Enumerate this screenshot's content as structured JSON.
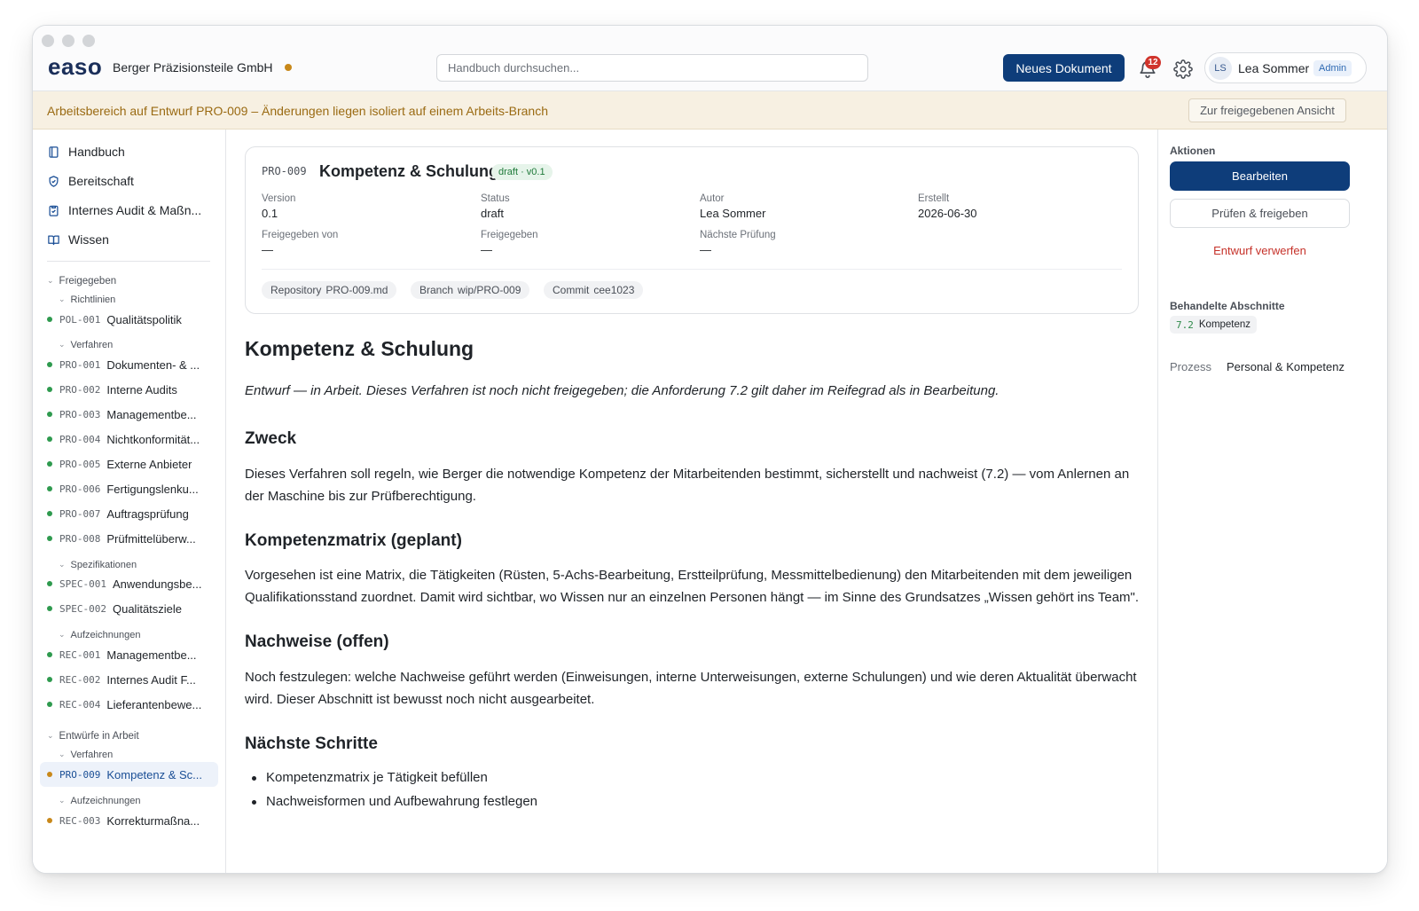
{
  "app": {
    "logo": "easo",
    "company": "Berger Präzisionsteile GmbH",
    "search_placeholder": "Handbuch durchsuchen...",
    "new_doc_label": "Neues Dokument",
    "notifications_count": "12",
    "user": {
      "initials": "LS",
      "name": "Lea Sommer",
      "role": "Admin"
    }
  },
  "banner": {
    "text": "Arbeitsbereich auf Entwurf PRO-009 – Änderungen liegen isoliert auf einem Arbeits-Branch",
    "button": "Zur freigegebenen Ansicht"
  },
  "nav": [
    {
      "label": "Handbuch",
      "icon": "book-icon"
    },
    {
      "label": "Bereitschaft",
      "icon": "shield-icon"
    },
    {
      "label": "Internes Audit & Maßn...",
      "icon": "clipboard-icon"
    },
    {
      "label": "Wissen",
      "icon": "open-book-icon"
    }
  ],
  "tree": {
    "released": "Freigegeben",
    "policies": "Richtlinien",
    "procedures": "Verfahren",
    "specs": "Spezifikationen",
    "records": "Aufzeichnungen",
    "drafts": "Entwürfe in Arbeit",
    "draft_procedures": "Verfahren",
    "draft_records": "Aufzeichnungen",
    "docs": [
      {
        "code": "POL-001",
        "title": "Qualitätspolitik"
      },
      {
        "code": "PRO-001",
        "title": "Dokumenten- & ..."
      },
      {
        "code": "PRO-002",
        "title": "Interne Audits"
      },
      {
        "code": "PRO-003",
        "title": "Managementbe..."
      },
      {
        "code": "PRO-004",
        "title": "Nichtkonformität..."
      },
      {
        "code": "PRO-005",
        "title": "Externe Anbieter"
      },
      {
        "code": "PRO-006",
        "title": "Fertigungslenku..."
      },
      {
        "code": "PRO-007",
        "title": "Auftragsprüfung"
      },
      {
        "code": "PRO-008",
        "title": "Prüfmittelüberw..."
      },
      {
        "code": "SPEC-001",
        "title": "Anwendungsbe..."
      },
      {
        "code": "SPEC-002",
        "title": "Qualitätsziele"
      },
      {
        "code": "REC-001",
        "title": "Managementbe..."
      },
      {
        "code": "REC-002",
        "title": "Internes Audit F..."
      },
      {
        "code": "REC-004",
        "title": "Lieferantenbewe..."
      },
      {
        "code": "PRO-009",
        "title": "Kompetenz & Sc..."
      },
      {
        "code": "REC-003",
        "title": "Korrekturmaßna..."
      }
    ]
  },
  "colors": {
    "released_dot": "#2e9a4e",
    "draft_dot": "#c8881a",
    "accent": "#0e3d7a"
  },
  "card": {
    "code": "PRO-009",
    "title": "Kompetenz & Schulung",
    "pill": "draft · v0.1",
    "meta": [
      {
        "label": "Version",
        "value": "0.1"
      },
      {
        "label": "Status",
        "value": "draft"
      },
      {
        "label": "Autor",
        "value": "Lea Sommer"
      },
      {
        "label": "Erstellt",
        "value": "2026-06-30"
      },
      {
        "label": "Freigegeben von",
        "value": "—"
      },
      {
        "label": "Freigegeben",
        "value": "—"
      },
      {
        "label": "Nächste Prüfung",
        "value": "—"
      }
    ],
    "chips": [
      {
        "label": "Repository",
        "value": "PRO-009.md"
      },
      {
        "label": "Branch",
        "value": "wip/PRO-009"
      },
      {
        "label": "Commit",
        "value": "cee1023"
      }
    ]
  },
  "doc": {
    "h1": "Kompetenz & Schulung",
    "lead": "Entwurf — in Arbeit. Dieses Verfahren ist noch nicht freigegeben; die Anforderung 7.2 gilt daher im Reifegrad als in Bearbeitung.",
    "sections": [
      {
        "heading": "Zweck",
        "text": "Dieses Verfahren soll regeln, wie Berger die notwendige Kompetenz der Mitarbeitenden bestimmt, sicherstellt und nachweist (7.2) — vom Anlernen an der Maschine bis zur Prüfberechtigung."
      },
      {
        "heading": "Kompetenzmatrix (geplant)",
        "text": "Vorgesehen ist eine Matrix, die Tätigkeiten (Rüsten, 5-Achs-Bearbeitung, Erstteilprüfung, Messmittelbedienung) den Mitarbeitenden mit dem jeweiligen Qualifikationsstand zuordnet. Damit wird sichtbar, wo Wissen nur an einzelnen Personen hängt — im Sinne des Grundsatzes „Wissen gehört ins Team\"."
      },
      {
        "heading": "Nachweise (offen)",
        "text": "Noch festzulegen: welche Nachweise geführt werden (Einweisungen, interne Unterweisungen, externe Schulungen) und wie deren Aktualität überwacht wird. Dieser Abschnitt ist bewusst noch nicht ausgearbeitet."
      },
      {
        "heading": "Nächste Schritte",
        "items": [
          "Kompetenzmatrix je Tätigkeit befüllen",
          "Nachweisformen und Aufbewahrung festlegen"
        ]
      }
    ]
  },
  "actions": {
    "label": "Aktionen",
    "edit": "Bearbeiten",
    "review": "Prüfen & freigeben",
    "discard": "Entwurf verwerfen",
    "sections_label": "Behandelte Abschnitte",
    "section_num": "7.2",
    "section_name": "Kompetenz",
    "process_label": "Prozess",
    "process_value": "Personal & Kompetenz"
  }
}
